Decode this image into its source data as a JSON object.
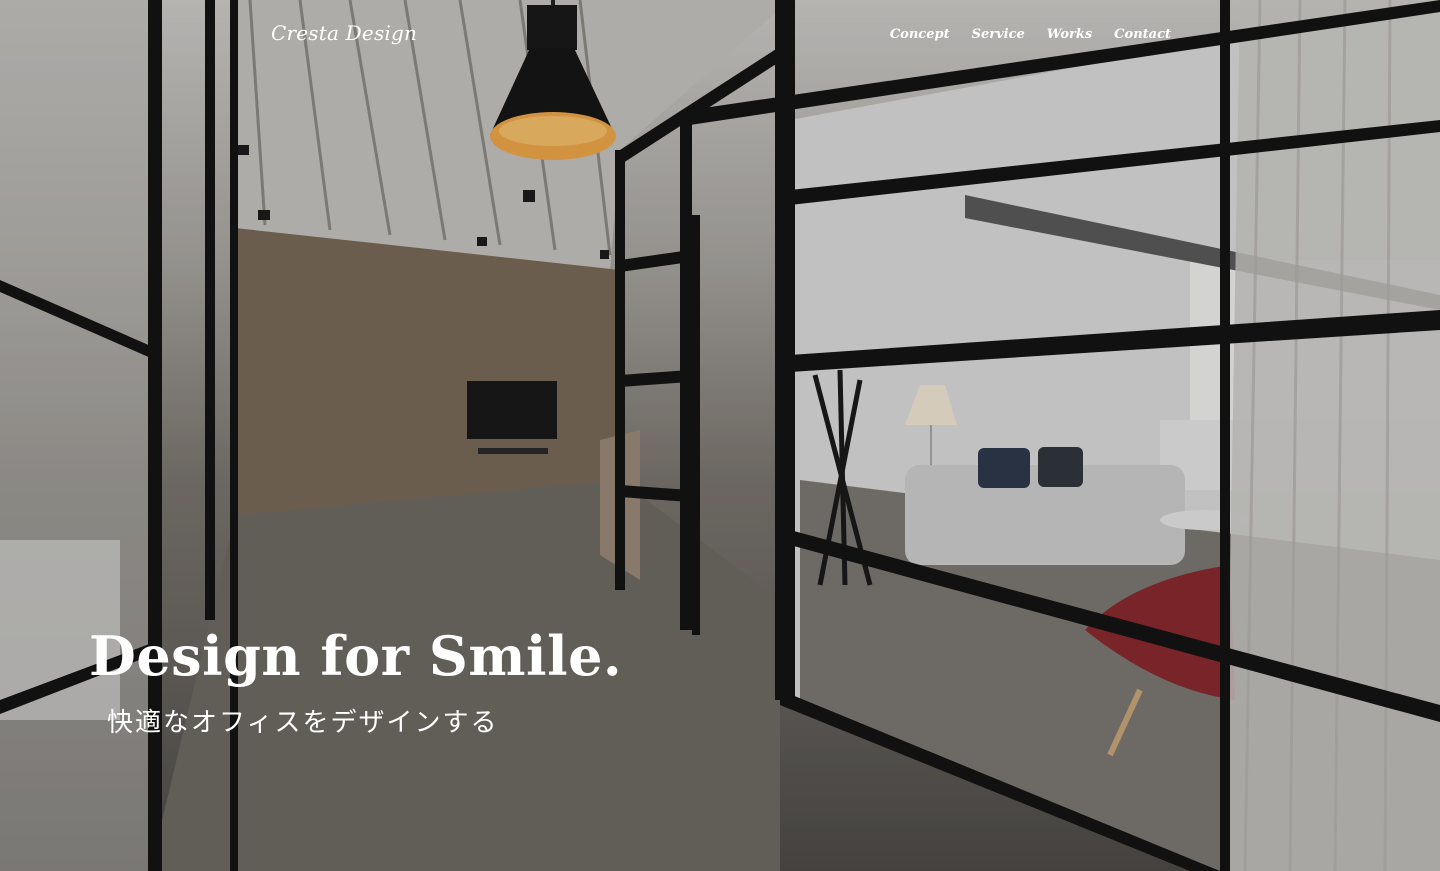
{
  "header": {
    "logo": "Cresta Design",
    "nav": [
      {
        "label": "Concept"
      },
      {
        "label": "Service"
      },
      {
        "label": "Works"
      },
      {
        "label": "Contact"
      }
    ]
  },
  "hero": {
    "headline": "Design for Smile.",
    "subline": "快適なオフィスをデザインする"
  },
  "colors": {
    "text": "#ffffff",
    "lamp_glow": "#f0a84a",
    "sofa": "#cfcfcf",
    "chair": "#8a2a2e",
    "frame": "#141414",
    "wood_wall": "#7a6a58"
  }
}
